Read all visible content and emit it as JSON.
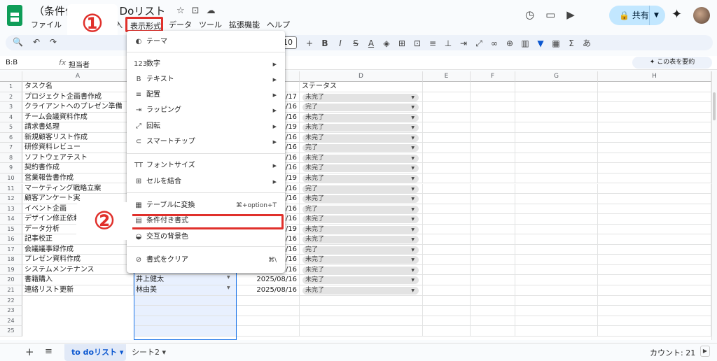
{
  "app": {
    "title_prefix": "（条件付",
    "title_suffix": "To Doリスト",
    "menu": [
      "ファイル",
      "入",
      "データ",
      "ツール",
      "拡張機能",
      "ヘルプ"
    ],
    "menu_highlighted": "表示形式",
    "share_label": "共有",
    "badge1": "①",
    "badge2": "②"
  },
  "toolbar": {
    "font_size": "10"
  },
  "formula_bar": {
    "name_box": "B:B",
    "fx": "fx",
    "content": "担当者",
    "summarize": "✦ この表を要約"
  },
  "columns": [
    "A",
    "B",
    "C",
    "D",
    "E",
    "F",
    "G",
    "H"
  ],
  "header_row": {
    "task": "タスク名",
    "status": "ステータス"
  },
  "rows": [
    {
      "n": "2",
      "task": "プロジェクト企画書作成",
      "person": "",
      "date": "07/17",
      "status": "未完了"
    },
    {
      "n": "3",
      "task": "クライアントへのプレゼン準備",
      "person": "",
      "date": "06/16",
      "status": "完了"
    },
    {
      "n": "4",
      "task": "チーム会議資料作成",
      "person": "",
      "date": "08/16",
      "status": "未完了"
    },
    {
      "n": "5",
      "task": "請求書処理",
      "person": "",
      "date": "07/19",
      "status": "未完了"
    },
    {
      "n": "6",
      "task": "新規顧客リスト作成",
      "person": "",
      "date": "08/16",
      "status": "未完了"
    },
    {
      "n": "7",
      "task": "研修資料レビュー",
      "person": "",
      "date": "06/16",
      "status": "完了"
    },
    {
      "n": "8",
      "task": "ソフトウェアテスト",
      "person": "",
      "date": "08/16",
      "status": "未完了"
    },
    {
      "n": "9",
      "task": "契約書作成",
      "person": "",
      "date": "08/16",
      "status": "未完了"
    },
    {
      "n": "10",
      "task": "営業報告書作成",
      "person": "",
      "date": "07/19",
      "status": "未完了"
    },
    {
      "n": "11",
      "task": "マーケティング戦略立案",
      "person": "",
      "date": "06/16",
      "status": "完了"
    },
    {
      "n": "12",
      "task": "顧客アンケート実",
      "person": "",
      "date": "08/16",
      "status": "未完了"
    },
    {
      "n": "13",
      "task": "イベント企画",
      "person": "",
      "date": "06/16",
      "status": "完了"
    },
    {
      "n": "14",
      "task": "デザイン修正依頼",
      "person": "",
      "date": "08/16",
      "status": "未完了"
    },
    {
      "n": "15",
      "task": "データ分析",
      "person": "",
      "date": "07/19",
      "status": "未完了"
    },
    {
      "n": "16",
      "task": "記事校正",
      "person": "",
      "date": "08/16",
      "status": "未完了"
    },
    {
      "n": "17",
      "task": "会議議事録作成",
      "person": "",
      "date": "06/16",
      "status": "完了"
    },
    {
      "n": "18",
      "task": "プレゼン資料作成",
      "person": "",
      "date": "08/16",
      "status": "未完了"
    },
    {
      "n": "19",
      "task": "システムメンテナンス",
      "person": "伊藤结衣",
      "date": "2025/08/16",
      "status": "未完了"
    },
    {
      "n": "20",
      "task": "書籍購入",
      "person": "井上健太",
      "date": "2025/08/16",
      "status": "未完了"
    },
    {
      "n": "21",
      "task": "連絡リスト更新",
      "person": "林由美",
      "date": "2025/08/16",
      "status": "未完了"
    }
  ],
  "empty_rows": [
    "22",
    "23",
    "24",
    "25"
  ],
  "dropdown_menu": [
    {
      "icon": "◐",
      "label": "テーマ",
      "arrow": "",
      "shortcut": ""
    },
    {
      "icon": "123",
      "label": "数字",
      "arrow": "▶",
      "shortcut": ""
    },
    {
      "icon": "B",
      "label": "テキスト",
      "arrow": "▶",
      "shortcut": ""
    },
    {
      "icon": "≡",
      "label": "配置",
      "arrow": "▶",
      "shortcut": ""
    },
    {
      "icon": "⇥",
      "label": "ラッピング",
      "arrow": "▶",
      "shortcut": ""
    },
    {
      "icon": "⤢",
      "label": "回転",
      "arrow": "▶",
      "shortcut": ""
    },
    {
      "icon": "⊂",
      "label": "スマートチップ",
      "arrow": "▶",
      "shortcut": ""
    },
    {
      "icon": "TT",
      "label": "フォントサイズ",
      "arrow": "▶",
      "shortcut": ""
    },
    {
      "icon": "⊞",
      "label": "セルを結合",
      "arrow": "▶",
      "shortcut": ""
    },
    {
      "icon": "▦",
      "label": "テーブルに変換",
      "arrow": "",
      "shortcut": "⌘+option+T"
    },
    {
      "icon": "▤",
      "label": "条件付き書式",
      "arrow": "",
      "shortcut": ""
    },
    {
      "icon": "◒",
      "label": "交互の背景色",
      "arrow": "",
      "shortcut": ""
    },
    {
      "icon": "⊘",
      "label": "書式をクリア",
      "arrow": "",
      "shortcut": "⌘\\"
    }
  ],
  "bottom": {
    "add": "+",
    "list": "≡",
    "active_tab": "to doリスト ▾",
    "tab2": "シート2 ▾",
    "count": "カウント: 21",
    "arrow": "▶"
  }
}
